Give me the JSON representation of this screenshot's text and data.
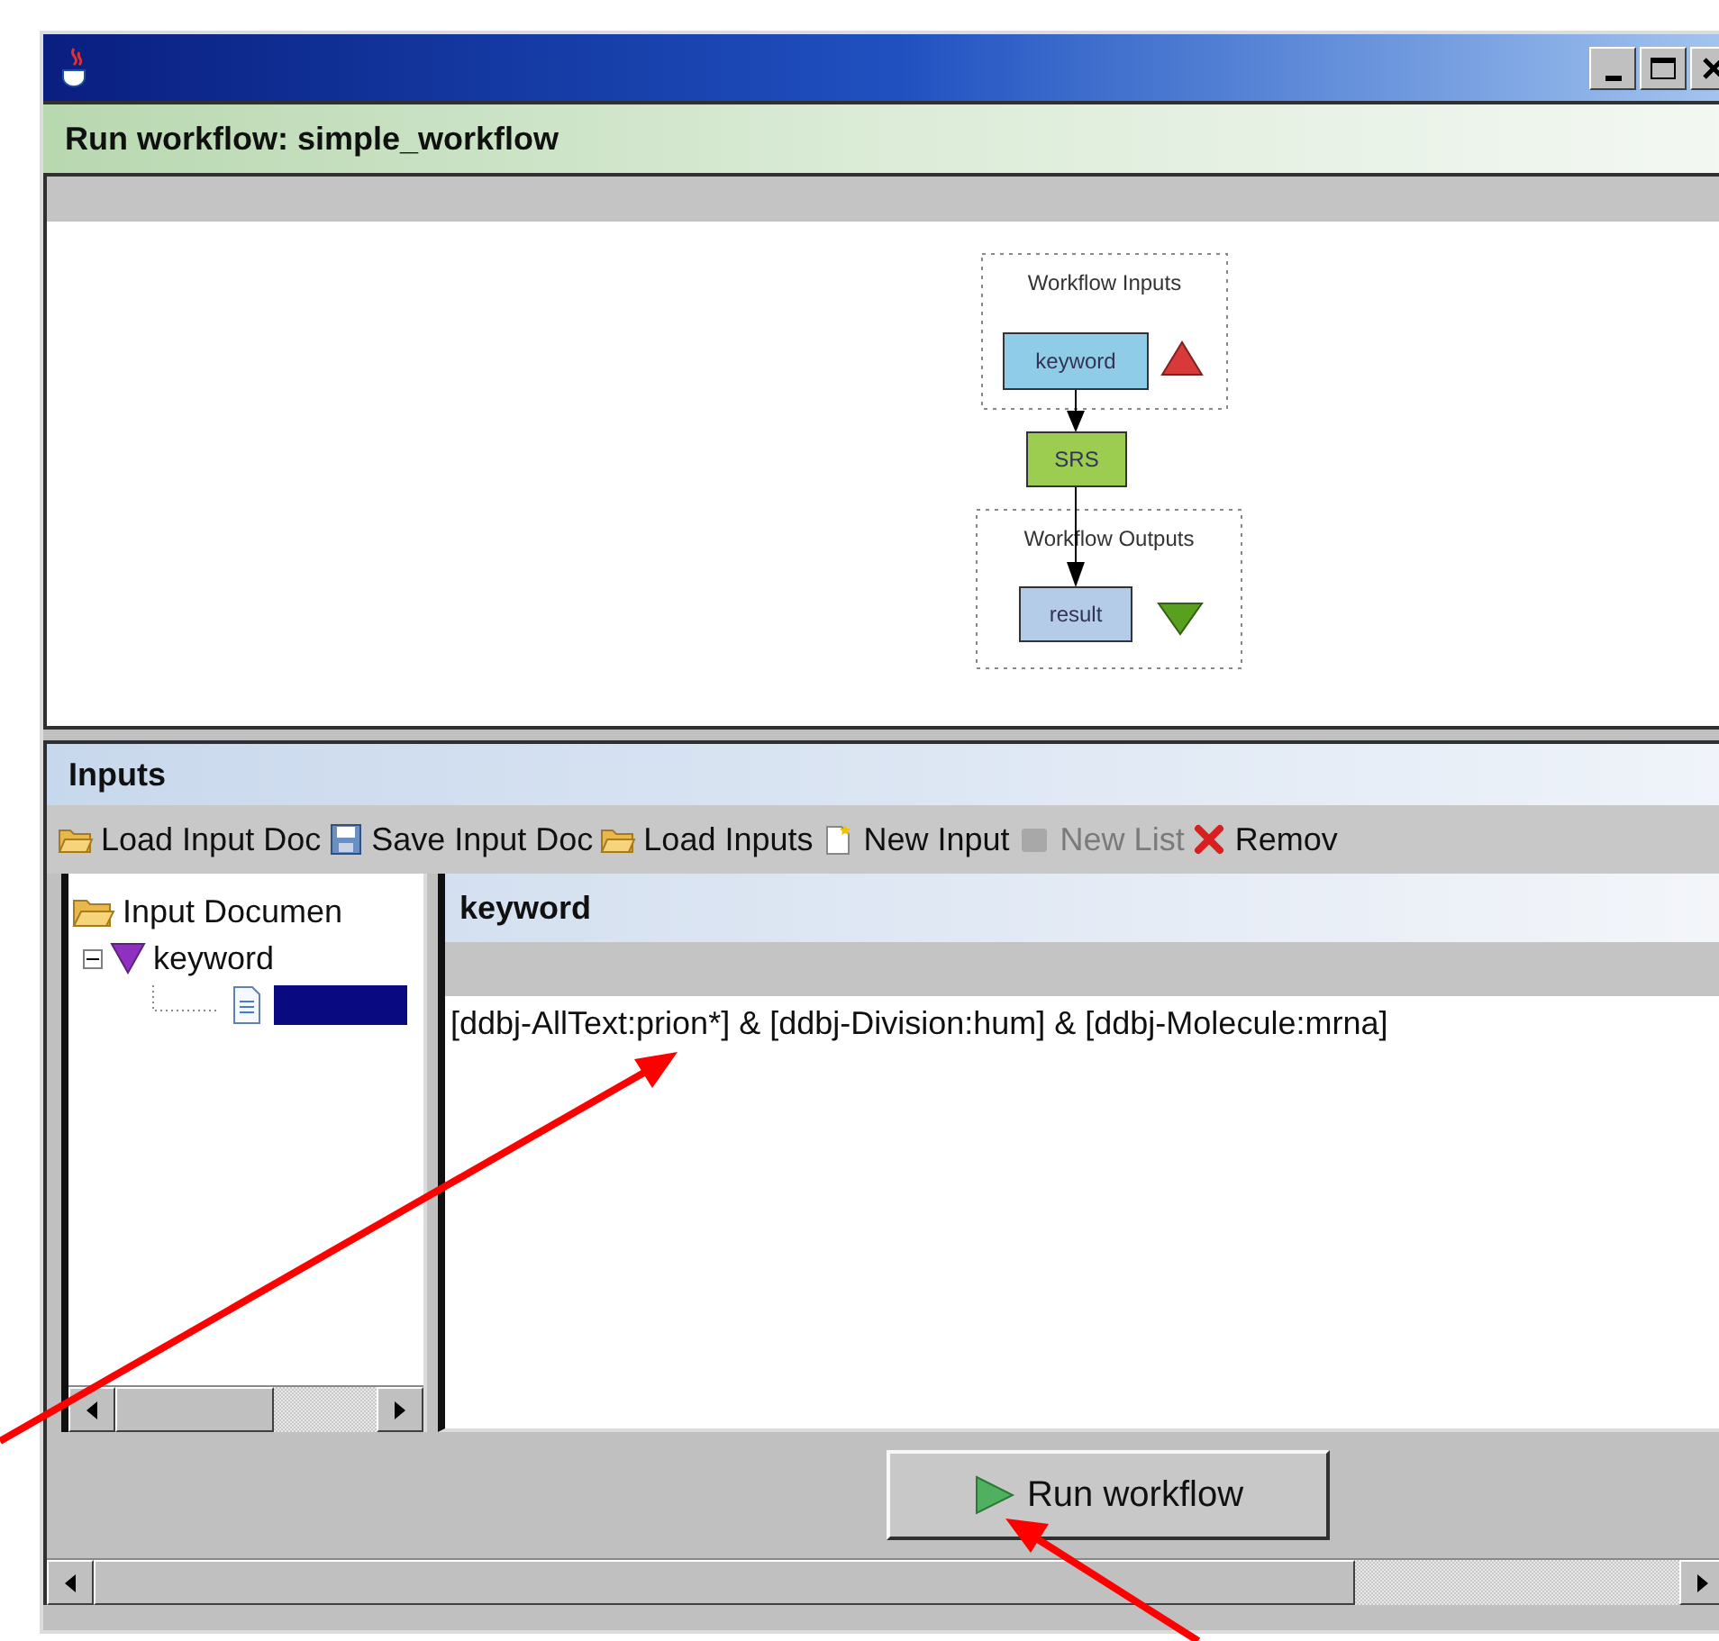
{
  "panel_title": "Run workflow: simple_workflow",
  "diagram": {
    "groups": [
      {
        "label": "Workflow Inputs"
      },
      {
        "label": "Workflow Outputs"
      }
    ],
    "nodes": [
      {
        "label": "keyword",
        "kind": "input"
      },
      {
        "label": "SRS",
        "kind": "processor"
      },
      {
        "label": "result",
        "kind": "output"
      }
    ]
  },
  "inputs": {
    "title": "Inputs",
    "toolbar": [
      {
        "label": "Load Input Doc",
        "kind": "open",
        "disabled": false
      },
      {
        "label": "Save Input Doc",
        "kind": "save",
        "disabled": false
      },
      {
        "label": "Load Inputs",
        "kind": "open",
        "disabled": false
      },
      {
        "label": "New Input",
        "kind": "new",
        "disabled": false
      },
      {
        "label": "New List",
        "kind": "list",
        "disabled": true
      },
      {
        "label": "Remov",
        "kind": "remove",
        "disabled": false
      }
    ],
    "tree": {
      "label": "Input Documen",
      "children": [
        {
          "label": "keyword",
          "expanded": true,
          "children": [
            {
              "selected": true
            }
          ]
        }
      ]
    },
    "editor": {
      "title": "keyword",
      "value": "[ddbj-AllText:prion*] & [ddbj-Division:hum] & [ddbj-Molecule:mrna]"
    }
  },
  "run_button": "Run workflow"
}
